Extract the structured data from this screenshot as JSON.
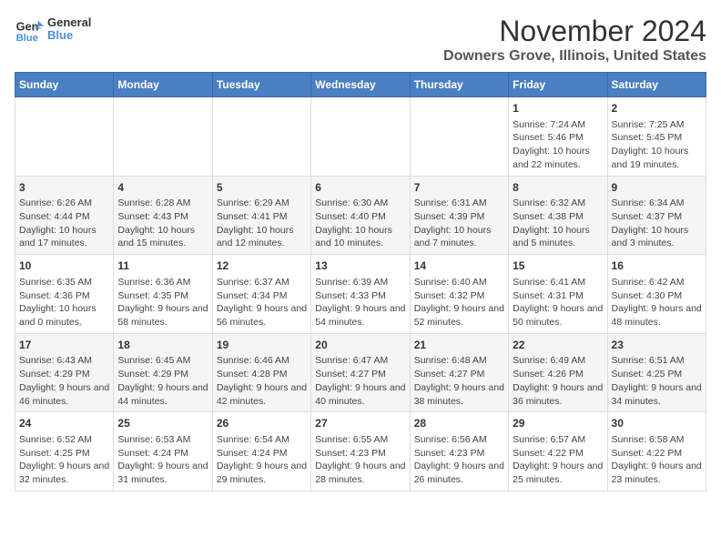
{
  "logo": {
    "line1": "General",
    "line2": "Blue"
  },
  "title": "November 2024",
  "subtitle": "Downers Grove, Illinois, United States",
  "weekdays": [
    "Sunday",
    "Monday",
    "Tuesday",
    "Wednesday",
    "Thursday",
    "Friday",
    "Saturday"
  ],
  "weeks": [
    [
      {
        "day": "",
        "info": ""
      },
      {
        "day": "",
        "info": ""
      },
      {
        "day": "",
        "info": ""
      },
      {
        "day": "",
        "info": ""
      },
      {
        "day": "",
        "info": ""
      },
      {
        "day": "1",
        "info": "Sunrise: 7:24 AM\nSunset: 5:46 PM\nDaylight: 10 hours and 22 minutes."
      },
      {
        "day": "2",
        "info": "Sunrise: 7:25 AM\nSunset: 5:45 PM\nDaylight: 10 hours and 19 minutes."
      }
    ],
    [
      {
        "day": "3",
        "info": "Sunrise: 6:26 AM\nSunset: 4:44 PM\nDaylight: 10 hours and 17 minutes."
      },
      {
        "day": "4",
        "info": "Sunrise: 6:28 AM\nSunset: 4:43 PM\nDaylight: 10 hours and 15 minutes."
      },
      {
        "day": "5",
        "info": "Sunrise: 6:29 AM\nSunset: 4:41 PM\nDaylight: 10 hours and 12 minutes."
      },
      {
        "day": "6",
        "info": "Sunrise: 6:30 AM\nSunset: 4:40 PM\nDaylight: 10 hours and 10 minutes."
      },
      {
        "day": "7",
        "info": "Sunrise: 6:31 AM\nSunset: 4:39 PM\nDaylight: 10 hours and 7 minutes."
      },
      {
        "day": "8",
        "info": "Sunrise: 6:32 AM\nSunset: 4:38 PM\nDaylight: 10 hours and 5 minutes."
      },
      {
        "day": "9",
        "info": "Sunrise: 6:34 AM\nSunset: 4:37 PM\nDaylight: 10 hours and 3 minutes."
      }
    ],
    [
      {
        "day": "10",
        "info": "Sunrise: 6:35 AM\nSunset: 4:36 PM\nDaylight: 10 hours and 0 minutes."
      },
      {
        "day": "11",
        "info": "Sunrise: 6:36 AM\nSunset: 4:35 PM\nDaylight: 9 hours and 58 minutes."
      },
      {
        "day": "12",
        "info": "Sunrise: 6:37 AM\nSunset: 4:34 PM\nDaylight: 9 hours and 56 minutes."
      },
      {
        "day": "13",
        "info": "Sunrise: 6:39 AM\nSunset: 4:33 PM\nDaylight: 9 hours and 54 minutes."
      },
      {
        "day": "14",
        "info": "Sunrise: 6:40 AM\nSunset: 4:32 PM\nDaylight: 9 hours and 52 minutes."
      },
      {
        "day": "15",
        "info": "Sunrise: 6:41 AM\nSunset: 4:31 PM\nDaylight: 9 hours and 50 minutes."
      },
      {
        "day": "16",
        "info": "Sunrise: 6:42 AM\nSunset: 4:30 PM\nDaylight: 9 hours and 48 minutes."
      }
    ],
    [
      {
        "day": "17",
        "info": "Sunrise: 6:43 AM\nSunset: 4:29 PM\nDaylight: 9 hours and 46 minutes."
      },
      {
        "day": "18",
        "info": "Sunrise: 6:45 AM\nSunset: 4:29 PM\nDaylight: 9 hours and 44 minutes."
      },
      {
        "day": "19",
        "info": "Sunrise: 6:46 AM\nSunset: 4:28 PM\nDaylight: 9 hours and 42 minutes."
      },
      {
        "day": "20",
        "info": "Sunrise: 6:47 AM\nSunset: 4:27 PM\nDaylight: 9 hours and 40 minutes."
      },
      {
        "day": "21",
        "info": "Sunrise: 6:48 AM\nSunset: 4:27 PM\nDaylight: 9 hours and 38 minutes."
      },
      {
        "day": "22",
        "info": "Sunrise: 6:49 AM\nSunset: 4:26 PM\nDaylight: 9 hours and 36 minutes."
      },
      {
        "day": "23",
        "info": "Sunrise: 6:51 AM\nSunset: 4:25 PM\nDaylight: 9 hours and 34 minutes."
      }
    ],
    [
      {
        "day": "24",
        "info": "Sunrise: 6:52 AM\nSunset: 4:25 PM\nDaylight: 9 hours and 32 minutes."
      },
      {
        "day": "25",
        "info": "Sunrise: 6:53 AM\nSunset: 4:24 PM\nDaylight: 9 hours and 31 minutes."
      },
      {
        "day": "26",
        "info": "Sunrise: 6:54 AM\nSunset: 4:24 PM\nDaylight: 9 hours and 29 minutes."
      },
      {
        "day": "27",
        "info": "Sunrise: 6:55 AM\nSunset: 4:23 PM\nDaylight: 9 hours and 28 minutes."
      },
      {
        "day": "28",
        "info": "Sunrise: 6:56 AM\nSunset: 4:23 PM\nDaylight: 9 hours and 26 minutes."
      },
      {
        "day": "29",
        "info": "Sunrise: 6:57 AM\nSunset: 4:22 PM\nDaylight: 9 hours and 25 minutes."
      },
      {
        "day": "30",
        "info": "Sunrise: 6:58 AM\nSunset: 4:22 PM\nDaylight: 9 hours and 23 minutes."
      }
    ]
  ]
}
